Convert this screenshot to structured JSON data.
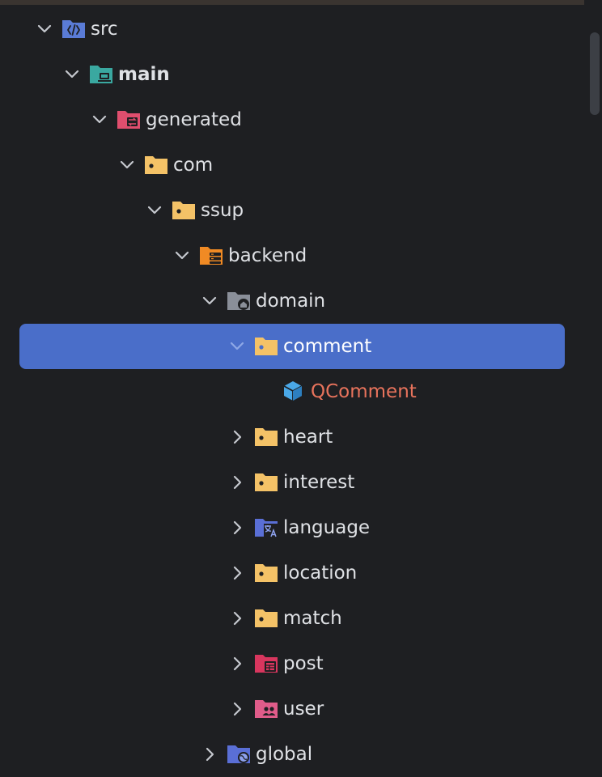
{
  "colors": {
    "background": "#1e1f22",
    "selection": "#4a6ec9",
    "text": "#dfe1e5",
    "class_text": "#e8735c"
  },
  "tree": {
    "items": [
      {
        "label": "src",
        "icon": "source-folder-icon",
        "expanded": true
      },
      {
        "label": "main",
        "icon": "main-module-folder-icon",
        "expanded": true
      },
      {
        "label": "generated",
        "icon": "generated-sources-folder-icon",
        "expanded": true
      },
      {
        "label": "com",
        "icon": "package-folder-icon",
        "expanded": true
      },
      {
        "label": "ssup",
        "icon": "package-folder-icon",
        "expanded": true
      },
      {
        "label": "backend",
        "icon": "backend-folder-icon",
        "expanded": true
      },
      {
        "label": "domain",
        "icon": "domain-folder-icon",
        "expanded": true
      },
      {
        "label": "comment",
        "icon": "package-folder-icon",
        "expanded": true,
        "selected": true
      },
      {
        "label": "QComment",
        "icon": "class-cube-icon"
      },
      {
        "label": "heart",
        "icon": "package-folder-icon",
        "expanded": false
      },
      {
        "label": "interest",
        "icon": "package-folder-icon",
        "expanded": false
      },
      {
        "label": "language",
        "icon": "language-folder-icon",
        "expanded": false
      },
      {
        "label": "location",
        "icon": "package-folder-icon",
        "expanded": false
      },
      {
        "label": "match",
        "icon": "package-folder-icon",
        "expanded": false
      },
      {
        "label": "post",
        "icon": "post-folder-icon",
        "expanded": false
      },
      {
        "label": "user",
        "icon": "user-folder-icon",
        "expanded": false
      },
      {
        "label": "global",
        "icon": "global-folder-icon",
        "expanded": false
      }
    ]
  }
}
